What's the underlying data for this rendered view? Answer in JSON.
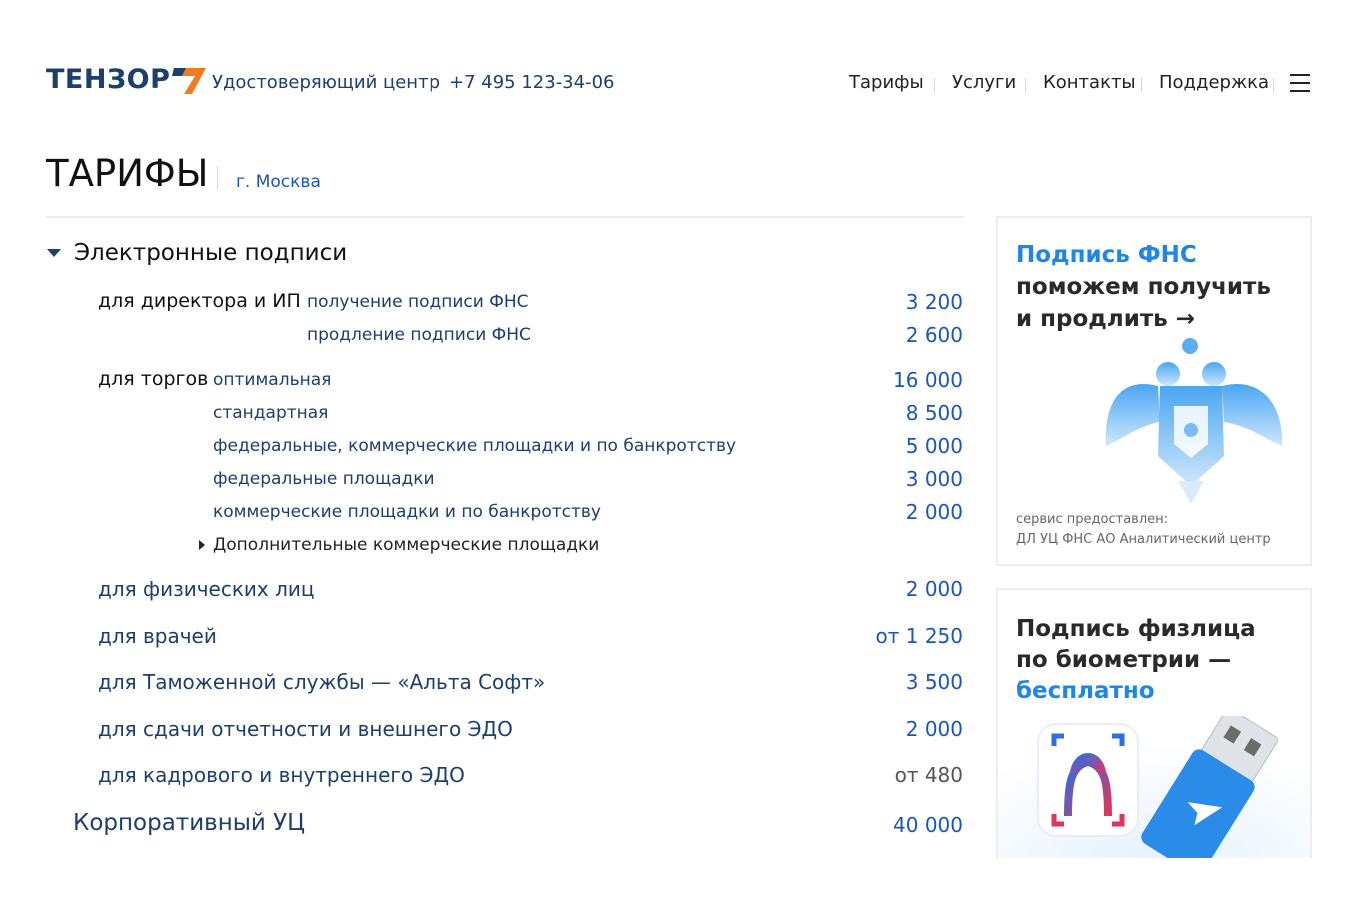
{
  "header": {
    "logo_text": "ТЕНЗОР",
    "subtitle": "Удостоверяющий центр",
    "phone": "+7 495 123-34-06",
    "nav": [
      "Тарифы",
      "Услуги",
      "Контакты",
      "Поддержка"
    ]
  },
  "page": {
    "title": "ТАРИФЫ",
    "city": "г. Москва"
  },
  "tariffs": {
    "section": "Электронные подписи",
    "director": {
      "label": "для директора и ИП",
      "items": [
        {
          "name": "получение подписи ФНС",
          "price": "3 200"
        },
        {
          "name": "продление подписи ФНС",
          "price": "2 600"
        }
      ]
    },
    "trade": {
      "label": "для торгов",
      "items": [
        {
          "name": "оптимальная",
          "price": "16 000"
        },
        {
          "name": "стандартная",
          "price": "8 500"
        },
        {
          "name": "федеральные, коммерческие площадки и по банкротству",
          "price": "5 000"
        },
        {
          "name": "федеральные площадки",
          "price": "3 000"
        },
        {
          "name": "коммерческие площадки и по банкротству",
          "price": "2 000"
        }
      ],
      "extra": "Дополнительные коммерческие площадки"
    },
    "rows": [
      {
        "name": "для физических лиц",
        "price": "2 000"
      },
      {
        "name": "для врачей",
        "price": "от 1 250"
      },
      {
        "name": "для Таможенной службы — «Альта Софт»",
        "price": "3 500"
      },
      {
        "name": "для сдачи отчетности и внешнего ЭДО",
        "price": "2 000"
      },
      {
        "name": "для кадрового и внутреннего ЭДО",
        "price": "от 480"
      }
    ],
    "corp": {
      "name": "Корпоративный УЦ",
      "price": "40 000"
    }
  },
  "banners": {
    "fns": {
      "line1": "Подпись ФНС",
      "line2": "поможем получить",
      "line3": "и продлить →",
      "foot1": "сервис предоставлен:",
      "foot2": "ДЛ УЦ ФНС АО Аналитический центр"
    },
    "bio": {
      "line1": "Подпись физлица",
      "line2": "по биометрии —",
      "line3": "бесплатно"
    }
  },
  "colors": {
    "brand": "#1b3f6e",
    "link": "#1a56b8",
    "accent_orange": "#f07c1d",
    "banner_blue": "#1d86e6"
  }
}
